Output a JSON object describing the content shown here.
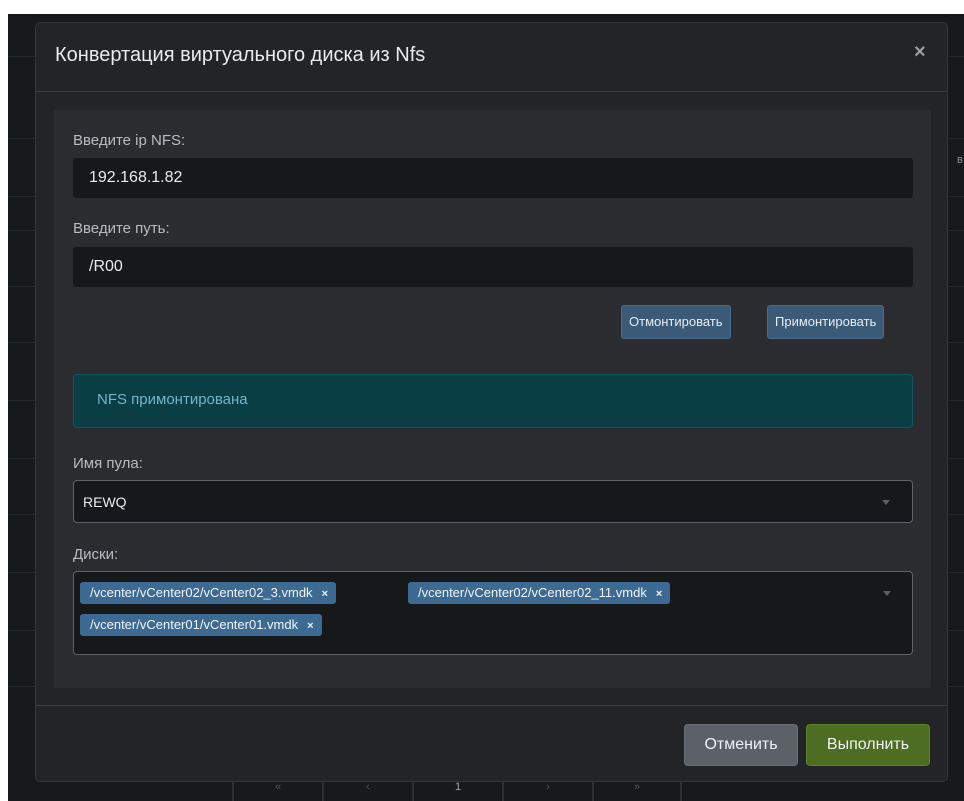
{
  "background": {
    "edge_text": "в",
    "pagination": [
      "«",
      "‹",
      "1",
      "›",
      "»"
    ]
  },
  "dialog": {
    "title": "Конвертация виртуального диска из Nfs",
    "close_label": "×",
    "nfs_ip": {
      "label": "Введите ip NFS:",
      "value": "192.168.1.82"
    },
    "path": {
      "label": "Введите путь:",
      "value": "/R00"
    },
    "unmount_label": "Отмонтировать",
    "mount_label": "Примонтировать",
    "alert_text": "NFS примонтирована",
    "pool": {
      "label": "Имя пула:",
      "value": "REWQ"
    },
    "disks": {
      "label": "Диски:",
      "selected": [
        "/vcenter/vCenter02/vCenter02_3.vmdk",
        "/vcenter/vCenter02/vCenter02_11.vmdk",
        "/vcenter/vCenter01/vCenter01.vmdk"
      ],
      "remove_label": "×"
    },
    "cancel_label": "Отменить",
    "submit_label": "Выполнить"
  },
  "colors": {
    "page_bg": "#17191c",
    "modal_bg": "#222426",
    "panel_bg": "#2a2c2f",
    "alert_bg": "#0a3e45",
    "alert_text": "#6fb6c9",
    "tag_bg": "#3c6a93",
    "button_primary": "#3b5a78",
    "button_success": "#4d6d22",
    "button_secondary": "#5b6167"
  }
}
